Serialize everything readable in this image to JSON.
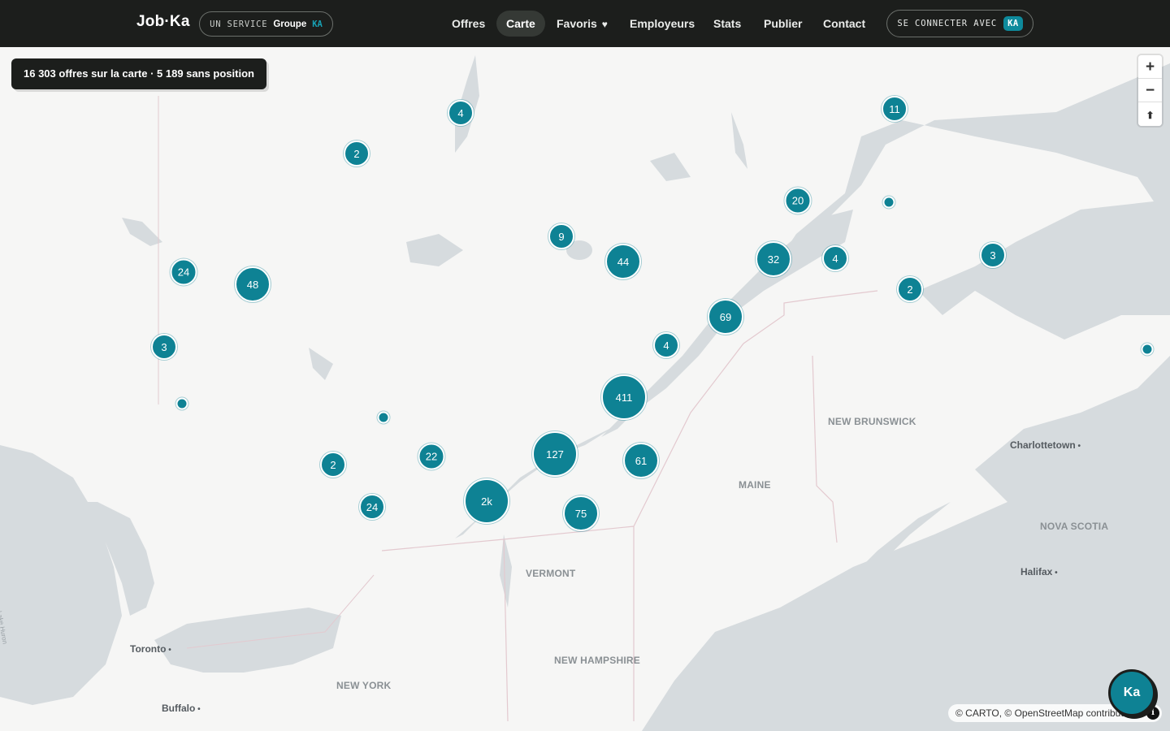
{
  "header": {
    "brand": "Job·Ka",
    "service_prefix": "UN SERVICE",
    "service_group": "Groupe",
    "service_ka": "KA",
    "nav": [
      {
        "label": "Offres"
      },
      {
        "label": "Carte"
      },
      {
        "label": "Favoris"
      },
      {
        "label": "Employeurs"
      },
      {
        "label": "Stats"
      },
      {
        "label": "Publier"
      },
      {
        "label": "Contact"
      }
    ],
    "active_nav": "Carte",
    "login_label": "SE CONNECTER AVEC",
    "login_badge": "KA"
  },
  "map": {
    "summary": "16 303 offres sur la carte · 5 189 sans position",
    "clusters": [
      "4",
      "2",
      "11",
      "20",
      "9",
      "44",
      "32",
      "4",
      "3",
      "24",
      "48",
      "2",
      "69",
      "3",
      "4",
      "411",
      "2",
      "22",
      "127",
      "61",
      "24",
      "2k",
      "75"
    ],
    "regions": [
      "NEW BRUNSWICK",
      "MAINE",
      "VERMONT",
      "NOVA SCOTIA",
      "NEW HAMPSHIRE",
      "NEW YORK"
    ],
    "cities": [
      "Charlottetown",
      "Halifax",
      "Toronto",
      "Buffalo"
    ],
    "lake_label": "Lake Huron",
    "zoom_in": "+",
    "zoom_out": "−",
    "reset_north": "⬆",
    "attribution": "© CARTO, © OpenStreetMap contributors",
    "fab_label": "Ka"
  },
  "colors": {
    "topbar": "#1c1e1c",
    "accent": "#0e8294",
    "land": "#f6f6f5",
    "water": "#d6dbde"
  }
}
